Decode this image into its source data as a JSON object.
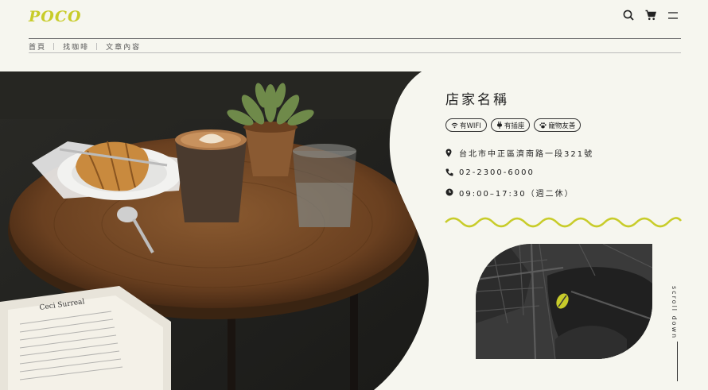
{
  "header": {
    "logo_text": "POCO",
    "brand_color": "#c8cc2a",
    "icons": [
      "search-icon",
      "cart-icon",
      "menu-icon"
    ]
  },
  "breadcrumb": [
    "首頁",
    "找咖啡",
    "文章內容"
  ],
  "store": {
    "name": "店家名稱",
    "tags": [
      {
        "icon": "wifi-icon",
        "label": "有WIFI"
      },
      {
        "icon": "plug-icon",
        "label": "有插座"
      },
      {
        "icon": "paw-icon",
        "label": "寵物友善"
      }
    ],
    "address": "台北市中正區濟南路一段321號",
    "phone": "02-2300-6000",
    "hours": "09:00–17:30（週二休）"
  },
  "scroll_hint": "scroll down",
  "book_text": "Ceci Surreal"
}
